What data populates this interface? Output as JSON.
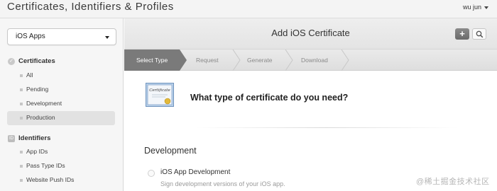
{
  "header": {
    "app_title": "Certificates, Identifiers & Profiles",
    "user_name": "wu jun"
  },
  "sidebar": {
    "platform_select": "iOS Apps",
    "sections": [
      {
        "label": "Certificates",
        "icon": "certificate-icon",
        "items": [
          {
            "label": "All"
          },
          {
            "label": "Pending"
          },
          {
            "label": "Development"
          },
          {
            "label": "Production",
            "active": true
          }
        ]
      },
      {
        "label": "Identifiers",
        "icon": "id-badge-icon",
        "icon_text": "ID",
        "items": [
          {
            "label": "App IDs"
          },
          {
            "label": "Pass Type IDs"
          },
          {
            "label": "Website Push IDs"
          }
        ]
      }
    ]
  },
  "main": {
    "title": "Add iOS Certificate",
    "add_icon": "plus-icon",
    "search_icon": "search-icon",
    "steps": [
      {
        "label": "Select Type",
        "active": true
      },
      {
        "label": "Request"
      },
      {
        "label": "Generate"
      },
      {
        "label": "Download"
      }
    ],
    "certificate_image": "certificate-icon",
    "certificate_image_text": "Certificate",
    "question": "What type of certificate do you need?",
    "section_title": "Development",
    "option": {
      "label": "iOS App Development",
      "description": "Sign development versions of your iOS app."
    }
  },
  "watermark": "@稀土掘金技术社区",
  "colors": {
    "active_step": "#777777",
    "active_nav": "#e2e2e2"
  }
}
